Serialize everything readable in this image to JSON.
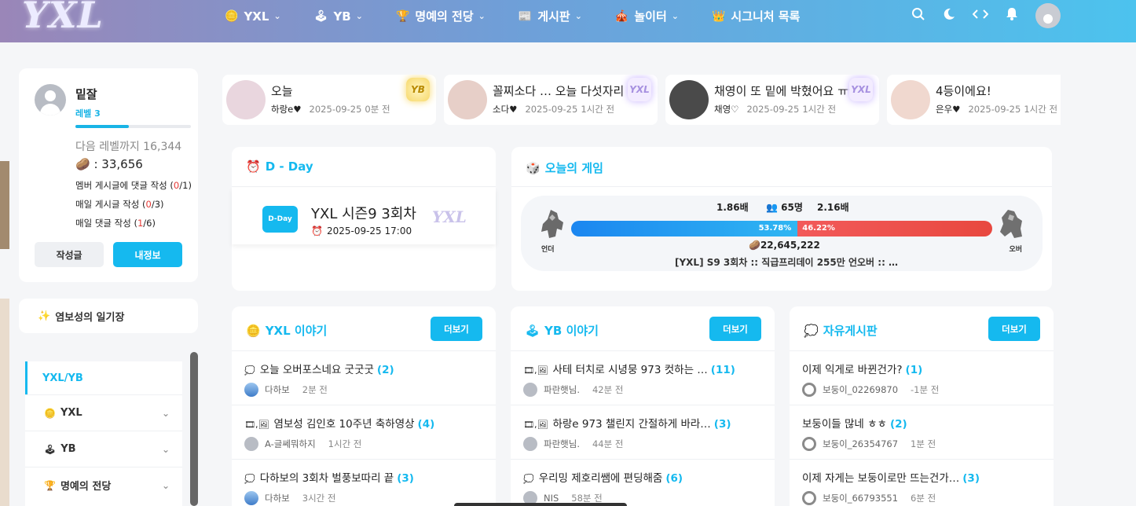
{
  "header": {
    "logo": "YXL",
    "nav": [
      {
        "icon": "🪙",
        "label": "YXL",
        "chev": "⌄"
      },
      {
        "icon": "🕹",
        "label": "YB",
        "chev": "⌄"
      },
      {
        "icon": "🏆",
        "label": "명예의 전당",
        "chev": "⌄"
      },
      {
        "icon": "📰",
        "label": "게시판",
        "chev": "⌄"
      },
      {
        "icon": "🎪",
        "label": "놀이터",
        "chev": "⌄"
      },
      {
        "icon": "👑",
        "label": "시그니처 목록",
        "chev": ""
      }
    ]
  },
  "profile": {
    "name": "밑잘",
    "level": "레벨 3",
    "progress_fraction": 0.46,
    "next_level": "다음 레벨까지 16,344",
    "coin": ": 33,656",
    "coin_icon": "🥔",
    "tasks": [
      {
        "label": "멤버 게시글에 댓글 작성 (",
        "cur": "0",
        "total": "/1)"
      },
      {
        "label": "매일 게시글 작성 (",
        "cur": "0",
        "total": "/3)"
      },
      {
        "label": "매일 댓글 작성 (",
        "cur": "1",
        "total": "/6)"
      }
    ],
    "write_button": "작성글",
    "info_button": "내정보"
  },
  "diary": {
    "icon": "✨",
    "label": "염보성의 일기장"
  },
  "sidemenu": {
    "head": "YXL/YB",
    "items": [
      {
        "icon": "🪙",
        "label": "YXL"
      },
      {
        "icon": "🕹",
        "label": "YB"
      },
      {
        "icon": "🏆",
        "label": "명예의 전당"
      }
    ]
  },
  "strip": [
    {
      "title": "오늘",
      "user": "하랑e♥",
      "date": "2025-09-25",
      "ago": "0분 전",
      "badge": "YB",
      "avatar_color": "#e9d6de"
    },
    {
      "title": "꼴찌소다 … 오늘 다섯자리 …",
      "user": "소다♥",
      "date": "2025-09-25",
      "ago": "1시간 전",
      "badge": "YXL",
      "avatar_color": "#e7cfc8"
    },
    {
      "title": "채영이 또 밑에 박혔어요 ㅠㅠㅠ",
      "user": "채영♡",
      "date": "2025-09-25",
      "ago": "1시간 전",
      "badge": "YXL",
      "avatar_color": "#4a4a4a"
    },
    {
      "title": "4등이에요!",
      "user": "은우♥",
      "date": "2025-09-25",
      "ago": "1시간 전",
      "badge": "",
      "avatar_color": "#f0d8cf"
    }
  ],
  "dday": {
    "icon": "⏰",
    "title": "D - Day",
    "badge": "D-Day",
    "event": "YXL 시즌9 3회차",
    "date": "2025-09-25 17:00",
    "logo": "YXL"
  },
  "game": {
    "icon": "🎲",
    "title": "오늘의 게임",
    "left_odds": "1.86배",
    "players": "65명",
    "right_odds": "2.16배",
    "left_pct": 53.78,
    "left_pct_label": "53.78%",
    "right_pct_label": "46.22%",
    "pot": "22,645,222",
    "left_side": "언더",
    "right_side": "오버",
    "question": "[YXL] S9 3회차 :: 직급프리데이 255만 언오버 :: …"
  },
  "boards": [
    {
      "icon": "🪙",
      "title": "YXL 이야기",
      "more": "더보기",
      "rows": [
        {
          "icons": "💭",
          "title": "오늘 오버포스네요 굿굿굿",
          "count": "(2)",
          "author": "다하보",
          "time": "2분 전",
          "av": "sky"
        },
        {
          "icons": "🎞,🖼",
          "title": "염보성 김인호 10주년 축하영상",
          "count": "(4)",
          "author": "A-글쎄뭐하지",
          "time": "1시간 전",
          "av": "gray"
        },
        {
          "icons": "💭",
          "title": "다하보의 3회차 벌풍보따리 끝",
          "count": "(3)",
          "author": "다하보",
          "time": "3시간 전",
          "av": "sky"
        }
      ]
    },
    {
      "icon": "🕹",
      "title": "YB 이야기",
      "more": "더보기",
      "rows": [
        {
          "icons": "🎞,🖼",
          "title": "사테 터치로 시녕뭉 973 컷하는 …",
          "count": "(11)",
          "author": "파란햇님.",
          "time": "42분 전",
          "av": "gray"
        },
        {
          "icons": "🎞,🖼",
          "title": "하랑e 973 챌린지 간절하게 바라…",
          "count": "(3)",
          "author": "파란햇님.",
          "time": "44분 전",
          "av": "gray"
        },
        {
          "icons": "💭",
          "title": "우리밍 제호리쌤에 편딩해줌",
          "count": "(6)",
          "author": "NIS",
          "time": "58분 전",
          "av": "gray"
        }
      ]
    },
    {
      "icon": "💭",
      "title": "자유게시판",
      "more": "더보기",
      "rows": [
        {
          "icons": "",
          "title": "이제 익게로 바뀐건가?",
          "count": "(1)",
          "author": "보둥이_02269870",
          "time": "-1분 전",
          "av": "ring"
        },
        {
          "icons": "",
          "title": "보둥이들 많네 ㅎㅎ",
          "count": "(2)",
          "author": "보둥이_26354767",
          "time": "1분 전",
          "av": "ring"
        },
        {
          "icons": "",
          "title": "이제 자게는 보둥이로만 뜨는건가…",
          "count": "(3)",
          "author": "보둥이_66793551",
          "time": "6분 전",
          "av": "ring"
        }
      ]
    }
  ],
  "colors": {
    "accent": "#15b9ef",
    "danger": "#e53935"
  }
}
